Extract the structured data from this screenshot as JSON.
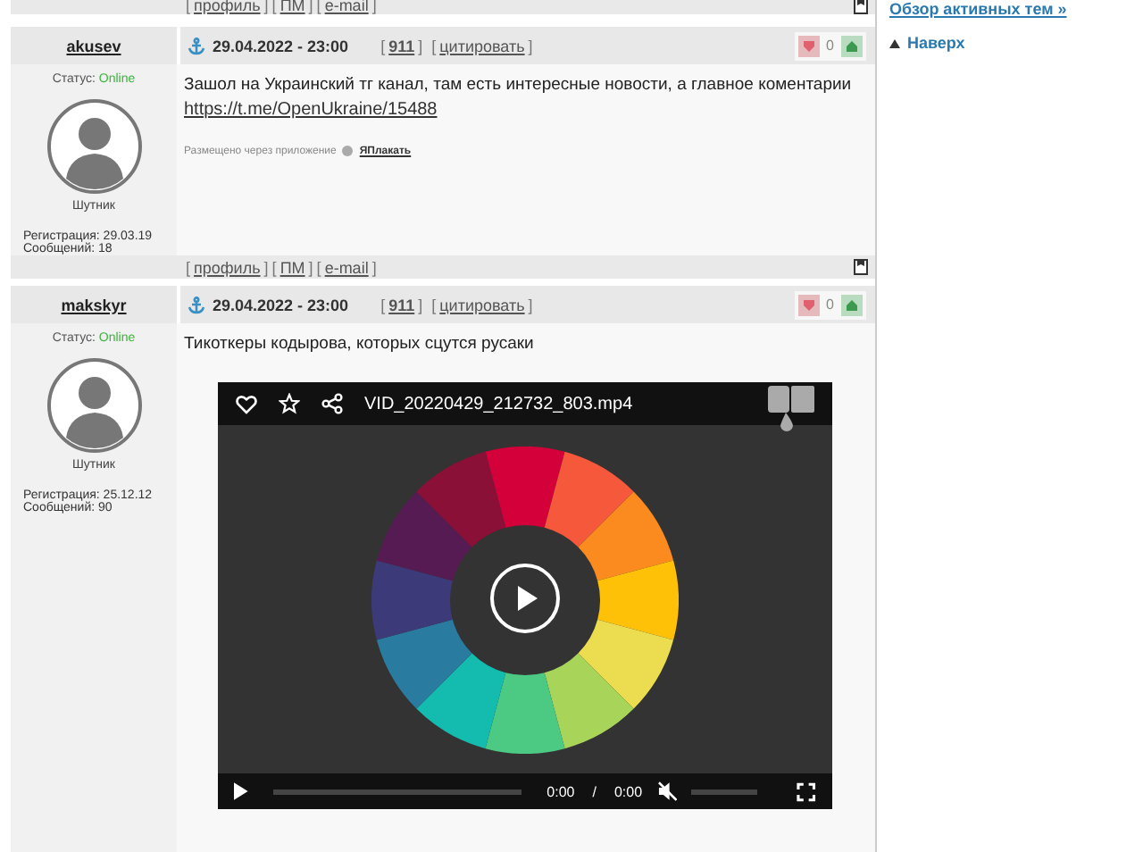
{
  "top_footer": {
    "links": [
      {
        "open": "[",
        "label": "профиль",
        "close": "]"
      },
      {
        "open": "[",
        "label": "ПМ",
        "close": "]"
      },
      {
        "open": "[",
        "label": "e-mail",
        "close": "]"
      }
    ]
  },
  "sidebar": {
    "active_topics_link": "Обзор активных тем »",
    "top_link": "Наверх"
  },
  "posts": [
    {
      "author": "akusev",
      "status_label": "Статус:",
      "status": "Online",
      "rank": "Шутник",
      "registration": "Регистрация: 29.03.19",
      "messages": "Сообщений: 18",
      "date": "29.04.2022 - 23:00",
      "rating": {
        "open": "[",
        "label": "911",
        "close": "]"
      },
      "quote": {
        "open": "[",
        "label": "цитировать",
        "close": "]"
      },
      "votes": "0",
      "text": "Зашол на Украинский тг канал, там есть интересные новости, а главное коментарии",
      "link": "https://t.me/OpenUkraine/15488",
      "via": {
        "text": "Размещено через приложение",
        "app": "ЯПлакать"
      },
      "footer_links": [
        {
          "open": "[",
          "label": "профиль",
          "close": "]"
        },
        {
          "open": "[",
          "label": "ПМ",
          "close": "]"
        },
        {
          "open": "[",
          "label": "e-mail",
          "close": "]"
        }
      ]
    },
    {
      "author": "makskyr",
      "status_label": "Статус:",
      "status": "Online",
      "rank": "Шутник",
      "registration": "Регистрация: 25.12.12",
      "messages": "Сообщений: 90",
      "date": "29.04.2022 - 23:00",
      "rating": {
        "open": "[",
        "label": "911",
        "close": "]"
      },
      "quote": {
        "open": "[",
        "label": "цитировать",
        "close": "]"
      },
      "votes": "0",
      "text": "Тикоткеры кодырова, которых сцутся русаки",
      "media": {
        "kind": "video",
        "filename": "VID_20220429_212732_803.mp4",
        "current_time": "0:00",
        "separator": "/",
        "duration": "0:00",
        "muted": true
      }
    }
  ]
}
